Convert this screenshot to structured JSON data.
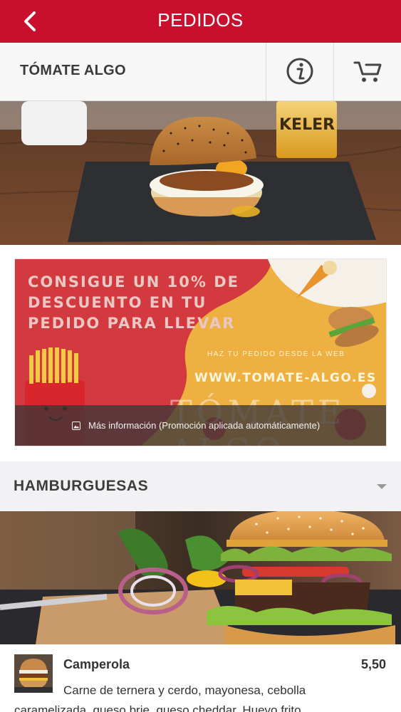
{
  "header": {
    "title": "PEDIDOS",
    "back_icon": "chevron-left-icon",
    "color": "#c8102e"
  },
  "restaurant": {
    "name": "TÓMATE ALGO",
    "info_icon": "info-icon",
    "cart_icon": "cart-icon"
  },
  "promo": {
    "headline_lines": [
      "CONSIGUE UN 10% DE",
      "DESCUENTO EN TU",
      "PEDIDO PARA LLEVAR"
    ],
    "subtext": "HAZ TU PEDIDO DESDE LA WEB",
    "url": "WWW.TOMATE-ALGO.ES",
    "logo_text": "TÓMATE ALGO",
    "info_label": "Más información (Promoción aplicada automáticamente)",
    "info_icon": "image-icon"
  },
  "section": {
    "title": "HAMBURGUESAS",
    "icon": "caret-down-icon"
  },
  "products": [
    {
      "name": "Camperola",
      "price": "5,50",
      "description_line1": "Carne de ternera y cerdo, mayonesa, cebolla",
      "description_line2": "caramelizada, queso brie, queso cheddar. Huevo frito."
    }
  ]
}
